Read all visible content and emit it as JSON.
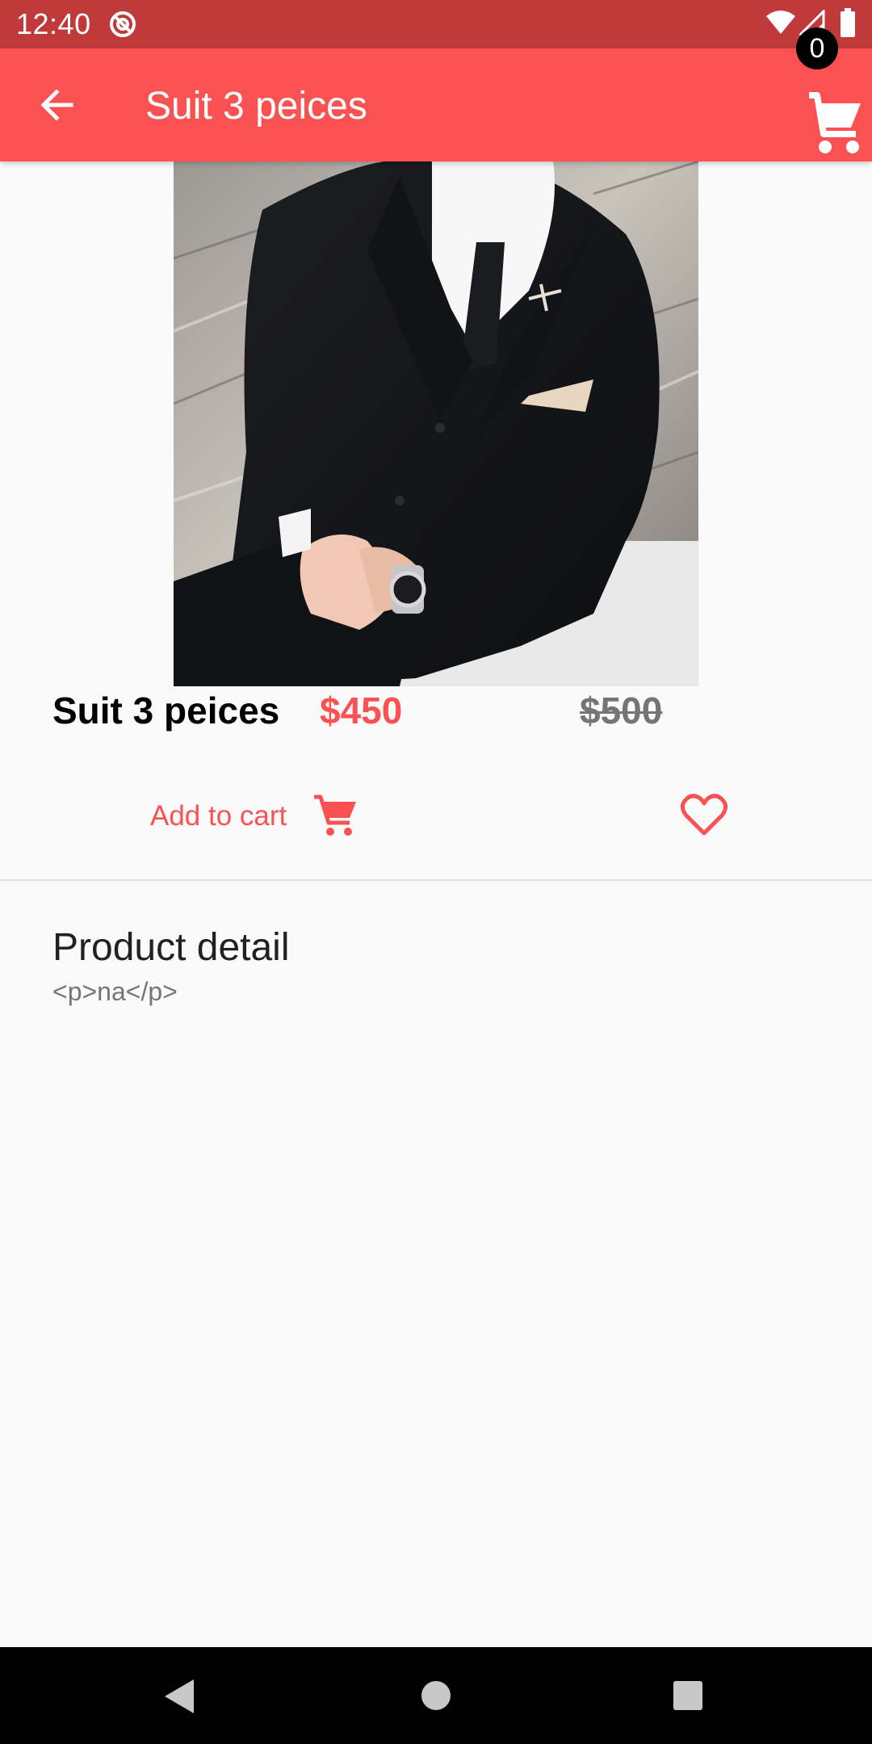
{
  "status_bar": {
    "time": "12:40",
    "icons": [
      "sync-disabled-icon",
      "wifi-icon",
      "cellular-signal-icon",
      "battery-icon"
    ]
  },
  "app_bar": {
    "title": "Suit 3 peices",
    "back_icon": "arrow-back-icon",
    "cart_icon": "shopping-cart-icon",
    "cart_count": "0"
  },
  "product": {
    "image": "product-photo",
    "name": "Suit 3 peices",
    "price": "$450",
    "old_price": "$500"
  },
  "actions": {
    "add_to_cart_label": "Add to cart",
    "add_to_cart_icon": "shopping-cart-icon",
    "favorite_icon": "heart-outline-icon"
  },
  "detail": {
    "heading": "Product detail",
    "body": "<p>na</p>"
  },
  "nav_bar": {
    "icons": [
      "nav-back-icon",
      "nav-home-icon",
      "nav-recents-icon"
    ]
  },
  "colors": {
    "accent": "#fa5252",
    "status_bar": "#c0393b",
    "old_price": "#757575",
    "background": "#fafafa"
  }
}
